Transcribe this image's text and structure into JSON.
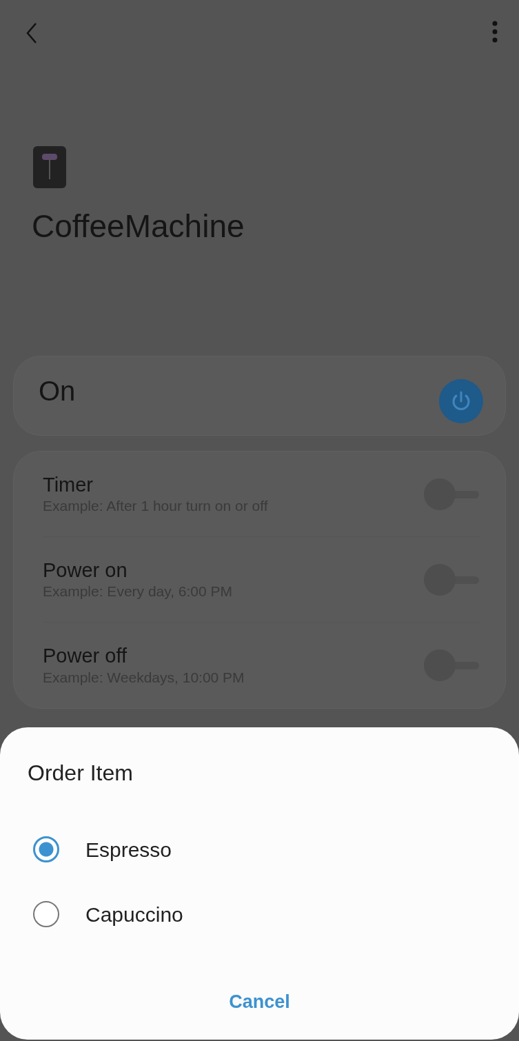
{
  "device": {
    "name": "CoffeeMachine"
  },
  "power": {
    "label": "On",
    "on": true
  },
  "schedules": [
    {
      "title": "Timer",
      "subtitle": "Example: After 1 hour turn on or off",
      "on": false
    },
    {
      "title": "Power on",
      "subtitle": "Example: Every day, 6:00 PM",
      "on": false
    },
    {
      "title": "Power off",
      "subtitle": "Example: Weekdays, 10:00 PM",
      "on": false
    }
  ],
  "dialog": {
    "title": "Order Item",
    "options": [
      {
        "label": "Espresso",
        "selected": true
      },
      {
        "label": "Capuccino",
        "selected": false
      }
    ],
    "cancel": "Cancel"
  }
}
